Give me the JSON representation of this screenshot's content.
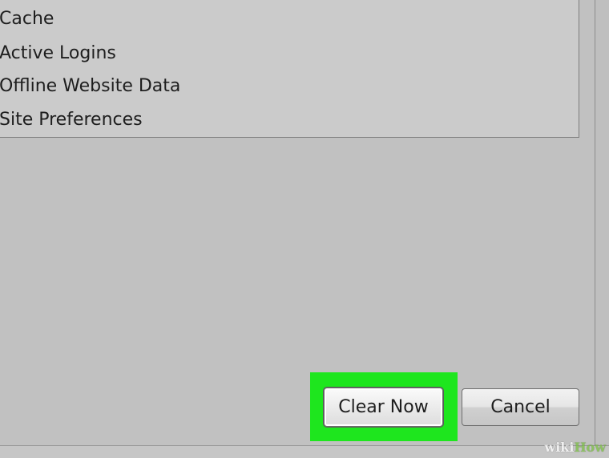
{
  "list": {
    "items": [
      "Cache",
      "Active Logins",
      "Offline Website Data",
      "Site Preferences"
    ]
  },
  "buttons": {
    "clear_now": "Clear Now",
    "cancel": "Cancel"
  },
  "watermark": {
    "part1": "wiki",
    "part2": "How"
  },
  "colors": {
    "highlight": "#1ee61e",
    "dialog_bg": "#c1c1c1"
  }
}
